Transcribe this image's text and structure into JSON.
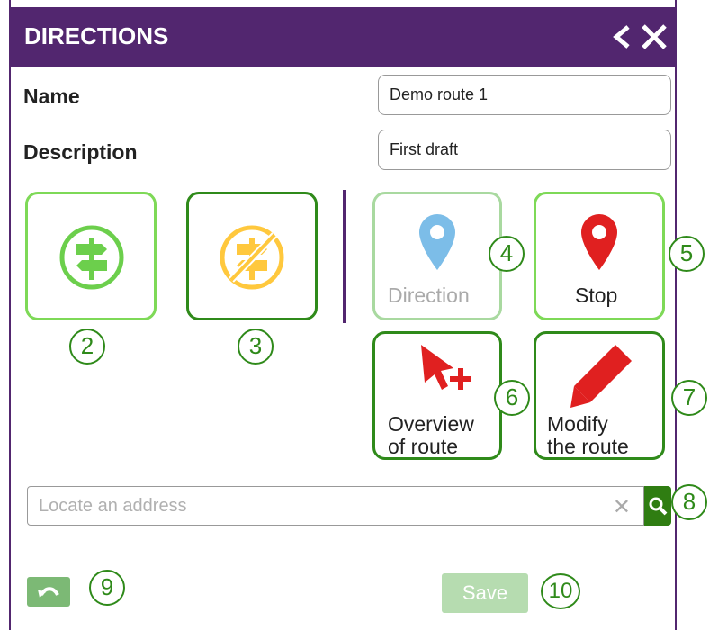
{
  "header": {
    "title": "DIRECTIONS"
  },
  "form": {
    "name_label": "Name",
    "name_value": "Demo route 1",
    "description_label": "Description",
    "description_value": "First draft"
  },
  "tools": {
    "direction_label": "Direction",
    "stop_label": "Stop",
    "overview_line1": "Overview",
    "overview_line2": "of route",
    "modify_line1": "Modify",
    "modify_line2": "the route"
  },
  "search": {
    "placeholder": "Locate an address",
    "clear_glyph": "✕"
  },
  "actions": {
    "save_label": "Save"
  },
  "callouts": {
    "c2": "2",
    "c3": "3",
    "c4": "4",
    "c5": "5",
    "c6": "6",
    "c7": "7",
    "c8": "8",
    "c9": "9",
    "c10": "10"
  },
  "colors": {
    "header": "#52266f",
    "accent_green": "#2f8a1a",
    "light_green": "#7ed957",
    "pin_red": "#e02020",
    "pin_blue": "#7cbde8",
    "sign_orange": "#ffc83d"
  },
  "icons": [
    "back-chevron-icon",
    "close-icon",
    "signpost-icon",
    "no-signpost-icon",
    "map-pin-icon",
    "cursor-plus-icon",
    "pencil-icon",
    "search-icon",
    "undo-icon"
  ]
}
